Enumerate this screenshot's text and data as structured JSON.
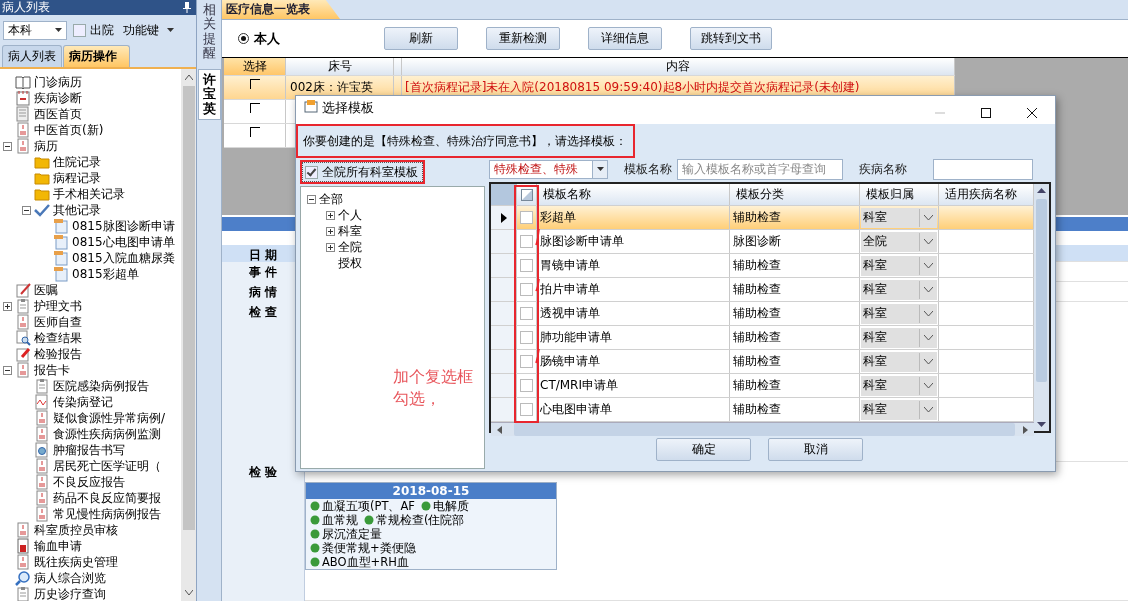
{
  "sidebar": {
    "title": "病人列表",
    "scope_combo": "本科",
    "discharged": {
      "label": "出院",
      "checked": false
    },
    "function_menu": "功能键",
    "tabs": [
      {
        "label": "病人列表",
        "selected": false
      },
      {
        "label": "病历操作",
        "selected": true
      }
    ],
    "tree": [
      {
        "label": "门诊病历",
        "kind": "book"
      },
      {
        "label": "疾病诊断",
        "kind": "calendar"
      },
      {
        "label": "西医首页",
        "kind": "page"
      },
      {
        "label": "中医首页(新)",
        "kind": "form"
      },
      {
        "label": "病历",
        "kind": "form",
        "expanded": true,
        "children": [
          {
            "label": "住院记录",
            "kind": "folder"
          },
          {
            "label": "病程记录",
            "kind": "folder"
          },
          {
            "label": "手术相关记录",
            "kind": "folder"
          },
          {
            "label": "其他记录",
            "kind": "check",
            "expanded": true,
            "children": [
              {
                "label": "0815脉图诊断申请",
                "kind": "file"
              },
              {
                "label": "0815心电图申请单",
                "kind": "file"
              },
              {
                "label": "0815入院血糖尿粪",
                "kind": "file"
              },
              {
                "label": "0815彩超单",
                "kind": "file"
              }
            ]
          }
        ]
      },
      {
        "label": "医嘱",
        "kind": "edit"
      },
      {
        "label": "护理文书",
        "kind": "clipboard",
        "expanded": false
      },
      {
        "label": "医师自查",
        "kind": "form"
      },
      {
        "label": "检查结果",
        "kind": "lens"
      },
      {
        "label": "检验报告",
        "kind": "flag"
      },
      {
        "label": "报告卡",
        "kind": "form",
        "expanded": true,
        "children": [
          {
            "label": "医院感染病例报告",
            "kind": "clipboard"
          },
          {
            "label": "传染病登记",
            "kind": "wave"
          },
          {
            "label": "疑似食源性异常病例/",
            "kind": "form"
          },
          {
            "label": "食源性疾病病例监测",
            "kind": "form"
          },
          {
            "label": "肿瘤报告书写",
            "kind": "target"
          },
          {
            "label": "居民死亡医学证明（",
            "kind": "form"
          },
          {
            "label": "不良反应报告",
            "kind": "form"
          },
          {
            "label": "药品不良反应简要报",
            "kind": "form"
          },
          {
            "label": "常见慢性病病例报告",
            "kind": "form"
          }
        ]
      },
      {
        "label": "科室质控员审核",
        "kind": "form"
      },
      {
        "label": "输血申请",
        "kind": "vial"
      },
      {
        "label": "既往疾病史管理",
        "kind": "form"
      },
      {
        "label": "病人综合浏览",
        "kind": "globe"
      },
      {
        "label": "历史诊疗查询",
        "kind": "clipboard"
      }
    ]
  },
  "side_tabs": [
    {
      "label": "相关提醒",
      "selected": false
    },
    {
      "label": "许宝英",
      "selected": true
    }
  ],
  "main": {
    "tab": "医疗信息一览表",
    "filter": {
      "label": "本人",
      "selected": true
    },
    "buttons": [
      "刷新",
      "重新检测",
      "详细信息",
      "跳转到文书"
    ],
    "table": {
      "columns": [
        "选择",
        "床号",
        "内容"
      ],
      "rows": [
        {
          "checked": false,
          "selected": true,
          "bed": "002床：许宝英",
          "content": "[首次病程记录]未在入院(20180815 09:59:40)起8小时内提交首次病程记录(未创建)"
        },
        {
          "checked": false,
          "selected": false
        },
        {
          "checked": false,
          "selected": false
        }
      ]
    }
  },
  "timeline": {
    "labels": [
      "日 期",
      "事 件",
      "病 情",
      "检 查",
      "检 验"
    ],
    "card": {
      "date": "2018-08-15",
      "rows": [
        [
          "血凝五项(PT、AF",
          "电解质"
        ],
        [
          "血常规",
          "常规检查(住院部"
        ],
        [
          "尿沉渣定量"
        ],
        [
          "粪便常规+粪便隐"
        ],
        [
          "ABO血型+RH血"
        ]
      ]
    }
  },
  "dialog": {
    "title": "选择模板",
    "message": "你要创建的是【特殊检查、特殊治疗同意书】，请选择模板：",
    "all_departments": {
      "label": "全院所有科室模板",
      "checked": true
    },
    "tree": [
      {
        "label": "全部",
        "expanded": true,
        "children": [
          {
            "label": "个人",
            "expanded": false
          },
          {
            "label": "科室",
            "expanded": false
          },
          {
            "label": "全院",
            "expanded": false
          },
          {
            "label": "授权"
          }
        ]
      }
    ],
    "category_combo": "特殊检查、特殊",
    "name_label": "模板名称",
    "name_placeholder": "输入模板名称或首字母查询",
    "disease_label": "疾病名称",
    "grid": {
      "columns": [
        "模板名称",
        "模板分类",
        "模板归属",
        "适用疾病名称"
      ],
      "rows": [
        {
          "name": "彩超单",
          "category": "辅助检查",
          "owner": "科室",
          "checked": false,
          "selected": true
        },
        {
          "name": "脉图诊断申请单",
          "category": "脉图诊断",
          "owner": "全院",
          "checked": false,
          "selected": false
        },
        {
          "name": "胃镜申请单",
          "category": "辅助检查",
          "owner": "科室",
          "checked": false,
          "selected": false
        },
        {
          "name": "拍片申请单",
          "category": "辅助检查",
          "owner": "科室",
          "checked": false,
          "selected": false
        },
        {
          "name": "透视申请单",
          "category": "辅助检查",
          "owner": "科室",
          "checked": false,
          "selected": false
        },
        {
          "name": "肺功能申请单",
          "category": "辅助检查",
          "owner": "科室",
          "checked": false,
          "selected": false
        },
        {
          "name": "肠镜申请单",
          "category": "辅助检查",
          "owner": "科室",
          "checked": false,
          "selected": false
        },
        {
          "name": "CT/MRI申请单",
          "category": "辅助检查",
          "owner": "科室",
          "checked": false,
          "selected": false
        },
        {
          "name": "心电图申请单",
          "category": "辅助检查",
          "owner": "科室",
          "checked": false,
          "selected": false
        }
      ]
    },
    "buttons": [
      "确定",
      "取消"
    ]
  },
  "annotations": {
    "note": "加个复选框勾选，"
  }
}
